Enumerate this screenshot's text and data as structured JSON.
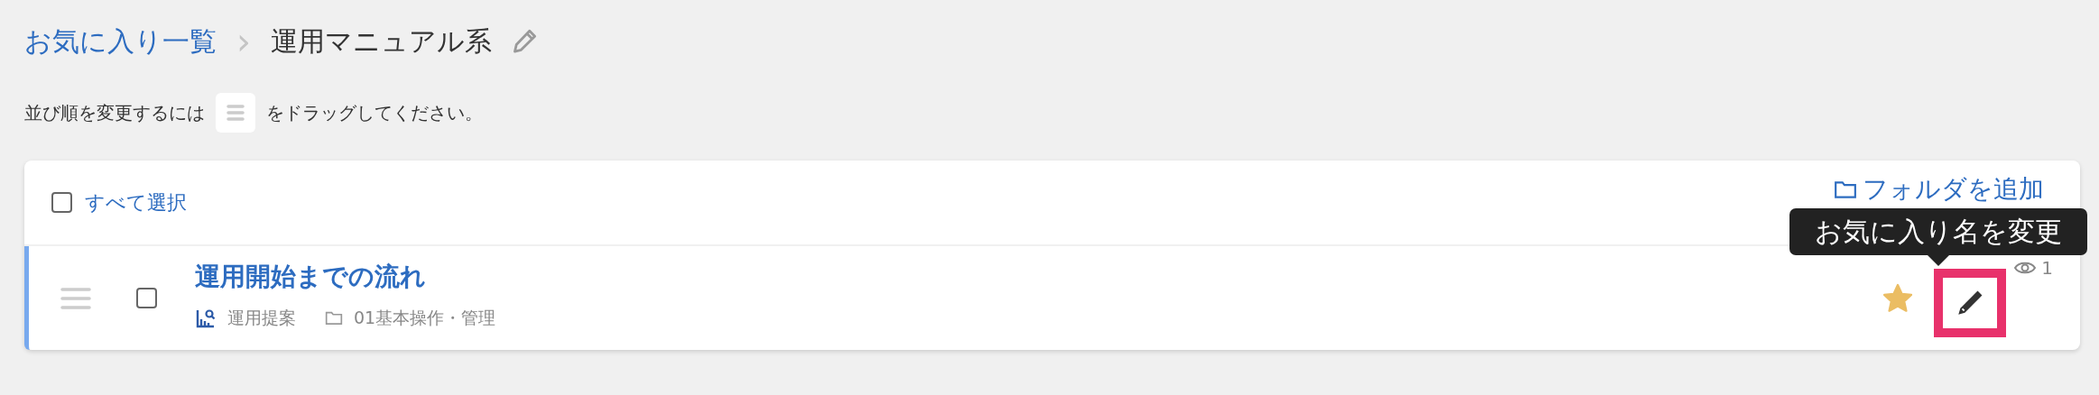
{
  "breadcrumb": {
    "parent": "お気に入り一覧",
    "separator": "›",
    "current": "運用マニュアル系"
  },
  "hint": {
    "before": "並び順を変更するには",
    "after": "をドラッグしてください。"
  },
  "list": {
    "select_all": {
      "label": "すべて選択",
      "checked": false
    },
    "add_folder": "フォルダを追加",
    "rows": [
      {
        "title": "運用開始までの流れ",
        "checked": false,
        "category": "運用提案",
        "folder": "01基本操作・管理",
        "views": "1",
        "starred": true,
        "edit_highlighted": true,
        "tooltip": "お気に入り名を変更"
      }
    ]
  }
}
